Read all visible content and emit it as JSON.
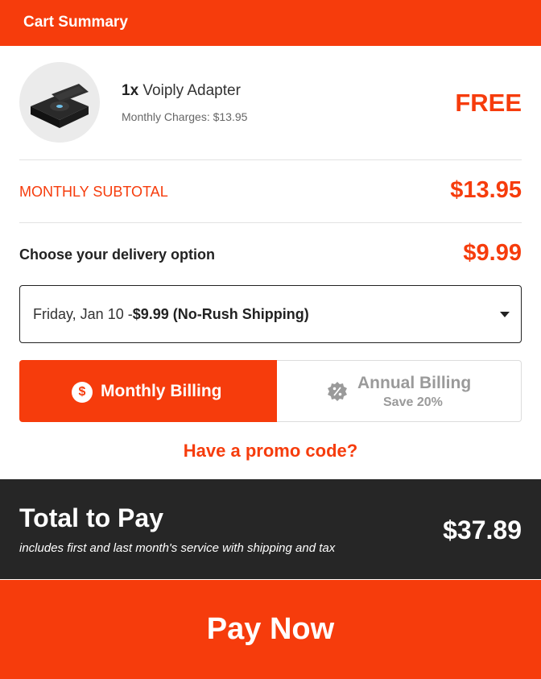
{
  "header": {
    "title": "Cart Summary"
  },
  "product": {
    "quantity": "1x",
    "name": "Voiply Adapter",
    "monthly_charges": "Monthly Charges: $13.95",
    "price": "FREE"
  },
  "subtotal": {
    "label": "MONTHLY SUBTOTAL",
    "value": "$13.95"
  },
  "delivery": {
    "label": "Choose your delivery option",
    "value": "$9.99",
    "selected_date": "Friday, Jan 10 -",
    "selected_option": "$9.99 (No-Rush Shipping)"
  },
  "billing": {
    "monthly_label": "Monthly Billing",
    "monthly_icon": "$",
    "annual_label": "Annual Billing",
    "annual_note": "Save 20%"
  },
  "promo": {
    "label": "Have a promo code?"
  },
  "total": {
    "title": "Total to Pay",
    "note": "includes first and last month's service with shipping and tax",
    "amount": "$37.89"
  },
  "pay": {
    "label": "Pay Now"
  },
  "colors": {
    "accent": "#f63c0c",
    "dark": "#262626"
  },
  "icons": {
    "product": "adapter-image",
    "monthly": "dollar-circle-icon",
    "annual": "percent-badge-icon",
    "dropdown": "chevron-down-icon"
  }
}
